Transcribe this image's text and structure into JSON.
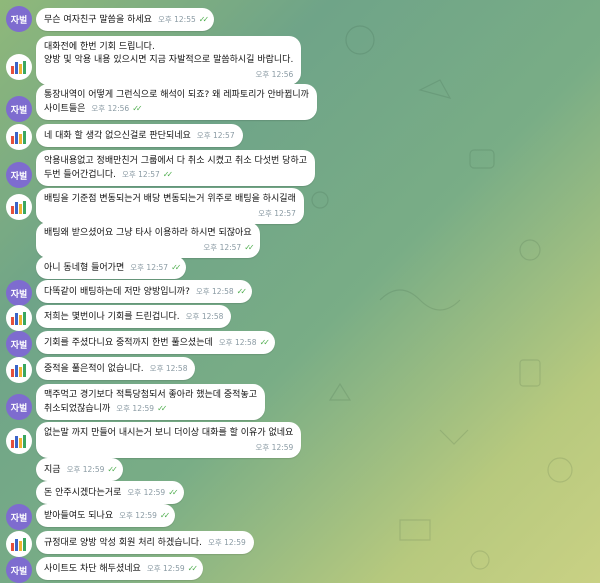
{
  "theme": {
    "incoming": "#ffffff",
    "outgoing": "#eeffde",
    "avatar_purple": "#7e6ccf",
    "tick": "#4fae4e"
  },
  "avatars": {
    "user_label": "자벌",
    "bot_icon": "bar-chart-logo-icon"
  },
  "messages": [
    {
      "from": "user",
      "text": "무슨 여자친구 말씀을 하세요",
      "time": "오후 12:55",
      "read": true
    },
    {
      "from": "bot",
      "text": "대화전에 한번 기회 드립니다.\n양방 및 악용 내용 있으시면 지금 자발적으로 말씀하시길 바랍니다.",
      "time": "오후 12:56",
      "read": false
    },
    {
      "from": "user",
      "text": "통장내역이 어떻게 그런식으로 해석이 되죠? 왜 레파토리가 안바뀝니까\n사이트들은",
      "time": "오후 12:56",
      "read": true
    },
    {
      "from": "bot",
      "text": "네 대화 할 생각 없으신걸로 판단되네요",
      "time": "오후 12:57",
      "read": false
    },
    {
      "from": "user",
      "text": "악용내용없고 정배만친거 그룹에서 다 취소 시켰고 취소 다섯번 당하고\n두번 들어간겁니다.",
      "time": "오후 12:57",
      "read": true
    },
    {
      "from": "bot",
      "text": "배팅을 기준점 변동되는거 배당 변동되는거 위주로 배팅을 하시길래",
      "time": "오후 12:57",
      "read": false
    },
    {
      "from": "user",
      "text": "배팅왜 받으셨어요 그냥 타사 이용하라 하시면 되잖아요",
      "time": "오후 12:57",
      "read": true
    },
    {
      "from": "user",
      "text": "아니 동네형 들어가면",
      "time": "오후 12:57",
      "read": true
    },
    {
      "from": "user",
      "text": "다똑같이 배팅하는데 저만 양방입니까?",
      "time": "오후 12:58",
      "read": true
    },
    {
      "from": "bot",
      "text": "저희는 몇번이나 기회를 드린겁니다.",
      "time": "오후 12:58",
      "read": false
    },
    {
      "from": "user",
      "text": "기회를 주셨다니요 중적까지 한번 풀으셨는데",
      "time": "오후 12:58",
      "read": true
    },
    {
      "from": "bot",
      "text": "중적을 풀은적이 없습니다.",
      "time": "오후 12:58",
      "read": false
    },
    {
      "from": "user",
      "text": "맥주먹고 경기보다 적특당첨되서 좋아라 했는데 중적놓고\n취소되었잖습니까",
      "time": "오후 12:59",
      "read": true
    },
    {
      "from": "bot",
      "text": "없는말 까지 만들어 내시는거 보니 더이상 대화를 할 이유가 없네요",
      "time": "오후 12:59",
      "read": false
    },
    {
      "from": "user",
      "text": "지금",
      "time": "오후 12:59",
      "read": true
    },
    {
      "from": "user",
      "text": "돈 안주시겠다는거로",
      "time": "오후 12:59",
      "read": true
    },
    {
      "from": "user",
      "text": "받아들여도 되나요",
      "time": "오후 12:59",
      "read": true
    },
    {
      "from": "bot",
      "text": "규정대로 양방 악성 회원 처리 하겠습니다.",
      "time": "오후 12:59",
      "read": false
    },
    {
      "from": "user",
      "text": "사이트도 차단 해두셨네요",
      "time": "오후 12:59",
      "read": true
    }
  ]
}
